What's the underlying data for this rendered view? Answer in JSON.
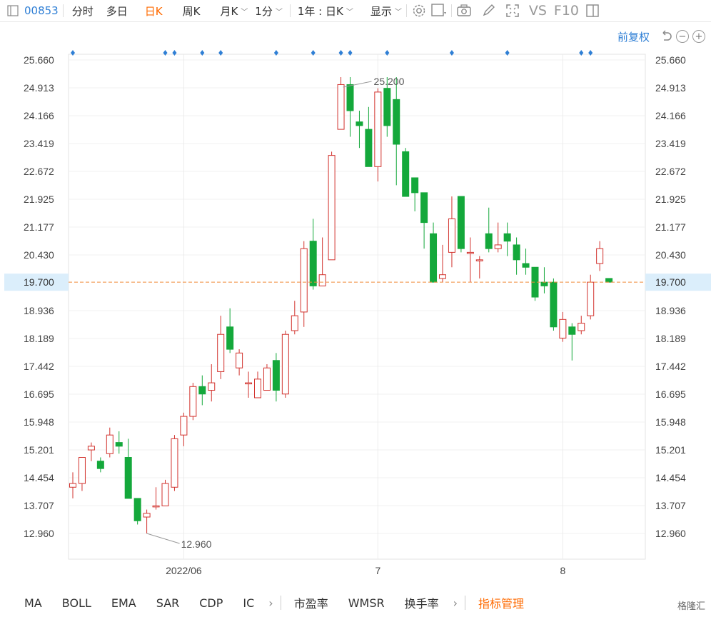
{
  "toolbar": {
    "code": "00853",
    "tabs": [
      "分时",
      "多日",
      "日K",
      "周K",
      "月K"
    ],
    "active_tab": "日K",
    "minute": "1分",
    "range": "1年 : 日K",
    "display": "显示",
    "vs": "VS",
    "f10": "F10"
  },
  "subbar": {
    "fq": "前复权"
  },
  "chart_data": {
    "type": "candlestick",
    "y_ticks": [
      "25.660",
      "24.913",
      "24.166",
      "23.419",
      "22.672",
      "21.925",
      "21.177",
      "20.430",
      "19.700",
      "18.936",
      "18.189",
      "17.442",
      "16.695",
      "15.948",
      "15.201",
      "14.454",
      "13.707",
      "12.960"
    ],
    "ylim": [
      12.96,
      25.66
    ],
    "x_labels": [
      {
        "label": "2022/06",
        "index": 12
      },
      {
        "label": "7",
        "index": 33
      },
      {
        "label": "8",
        "index": 53
      }
    ],
    "current_price": "19.700",
    "max_label": "25.200",
    "min_label": "12.960",
    "up_color": "#d2322d",
    "down_color": "#14a83b",
    "candles": [
      [
        14.2,
        14.3,
        14.6,
        13.9
      ],
      [
        14.3,
        15.0,
        15.0,
        14.1
      ],
      [
        15.2,
        15.3,
        15.4,
        14.9
      ],
      [
        14.9,
        14.7,
        15.0,
        14.6
      ],
      [
        15.1,
        15.6,
        15.8,
        15.0
      ],
      [
        15.4,
        15.3,
        15.7,
        15.1
      ],
      [
        15.0,
        13.9,
        15.5,
        13.9
      ],
      [
        13.9,
        13.3,
        13.9,
        13.2
      ],
      [
        13.4,
        13.5,
        13.6,
        12.96
      ],
      [
        13.7,
        13.7,
        14.2,
        13.6
      ],
      [
        13.7,
        14.3,
        14.4,
        13.7
      ],
      [
        14.2,
        15.5,
        15.6,
        14.1
      ],
      [
        15.6,
        16.1,
        16.2,
        15.3
      ],
      [
        16.1,
        16.9,
        17.0,
        16.0
      ],
      [
        16.9,
        16.7,
        17.2,
        16.4
      ],
      [
        16.8,
        17.0,
        17.5,
        16.5
      ],
      [
        17.3,
        18.3,
        18.8,
        17.1
      ],
      [
        18.5,
        17.9,
        19.0,
        17.8
      ],
      [
        17.4,
        17.8,
        17.9,
        17.2
      ],
      [
        17.0,
        17.0,
        17.3,
        16.6
      ],
      [
        16.6,
        17.1,
        17.3,
        16.6
      ],
      [
        16.8,
        17.4,
        17.5,
        16.8
      ],
      [
        17.6,
        16.8,
        17.8,
        16.5
      ],
      [
        16.7,
        18.3,
        18.4,
        16.6
      ],
      [
        18.4,
        18.8,
        19.2,
        18.3
      ],
      [
        18.9,
        20.6,
        20.8,
        18.5
      ],
      [
        20.8,
        19.6,
        21.4,
        19.5
      ],
      [
        19.6,
        19.9,
        20.9,
        19.6
      ],
      [
        20.3,
        23.1,
        23.2,
        20.3
      ],
      [
        23.8,
        25.0,
        25.2,
        23.8
      ],
      [
        25.0,
        24.3,
        25.2,
        23.6
      ],
      [
        24.0,
        23.9,
        24.3,
        23.3
      ],
      [
        23.8,
        22.8,
        24.4,
        22.8
      ],
      [
        22.8,
        24.8,
        24.9,
        22.4
      ],
      [
        24.9,
        23.9,
        25.2,
        23.6
      ],
      [
        24.6,
        23.4,
        25.2,
        22.3
      ],
      [
        23.2,
        22.0,
        23.3,
        22.0
      ],
      [
        22.5,
        22.1,
        22.5,
        21.6
      ],
      [
        22.1,
        21.3,
        22.1,
        20.6
      ],
      [
        21.0,
        19.7,
        21.3,
        19.7
      ],
      [
        19.8,
        19.9,
        20.7,
        19.7
      ],
      [
        20.5,
        21.4,
        22.0,
        20.1
      ],
      [
        22.0,
        20.6,
        22.0,
        20.5
      ],
      [
        20.5,
        20.5,
        20.9,
        19.7
      ],
      [
        20.3,
        20.3,
        20.4,
        19.8
      ],
      [
        21.0,
        20.6,
        21.7,
        20.5
      ],
      [
        20.6,
        20.7,
        21.3,
        20.5
      ],
      [
        21.0,
        20.8,
        21.3,
        20.4
      ],
      [
        20.7,
        20.3,
        20.9,
        19.9
      ],
      [
        20.2,
        20.1,
        20.6,
        19.9
      ],
      [
        20.1,
        19.3,
        20.1,
        19.2
      ],
      [
        19.7,
        19.6,
        20.1,
        19.4
      ],
      [
        19.7,
        18.5,
        19.8,
        18.4
      ],
      [
        18.2,
        18.7,
        18.9,
        18.1
      ],
      [
        18.5,
        18.3,
        18.6,
        17.6
      ],
      [
        18.4,
        18.6,
        18.8,
        18.3
      ],
      [
        18.8,
        19.7,
        19.9,
        18.7
      ],
      [
        20.2,
        20.6,
        20.8,
        20.0
      ],
      [
        19.8,
        19.7,
        19.8,
        19.7
      ]
    ],
    "markers": [
      0,
      10,
      11,
      14,
      16,
      22,
      26,
      29,
      30,
      34,
      41,
      47,
      55,
      56
    ]
  },
  "bottombar": {
    "items": [
      "MA",
      "BOLL",
      "EMA",
      "SAR",
      "CDP",
      "IC"
    ],
    "items2": [
      "市盈率",
      "WMSR",
      "换手率"
    ],
    "manage": "指标管理",
    "watermark": "格隆汇"
  }
}
